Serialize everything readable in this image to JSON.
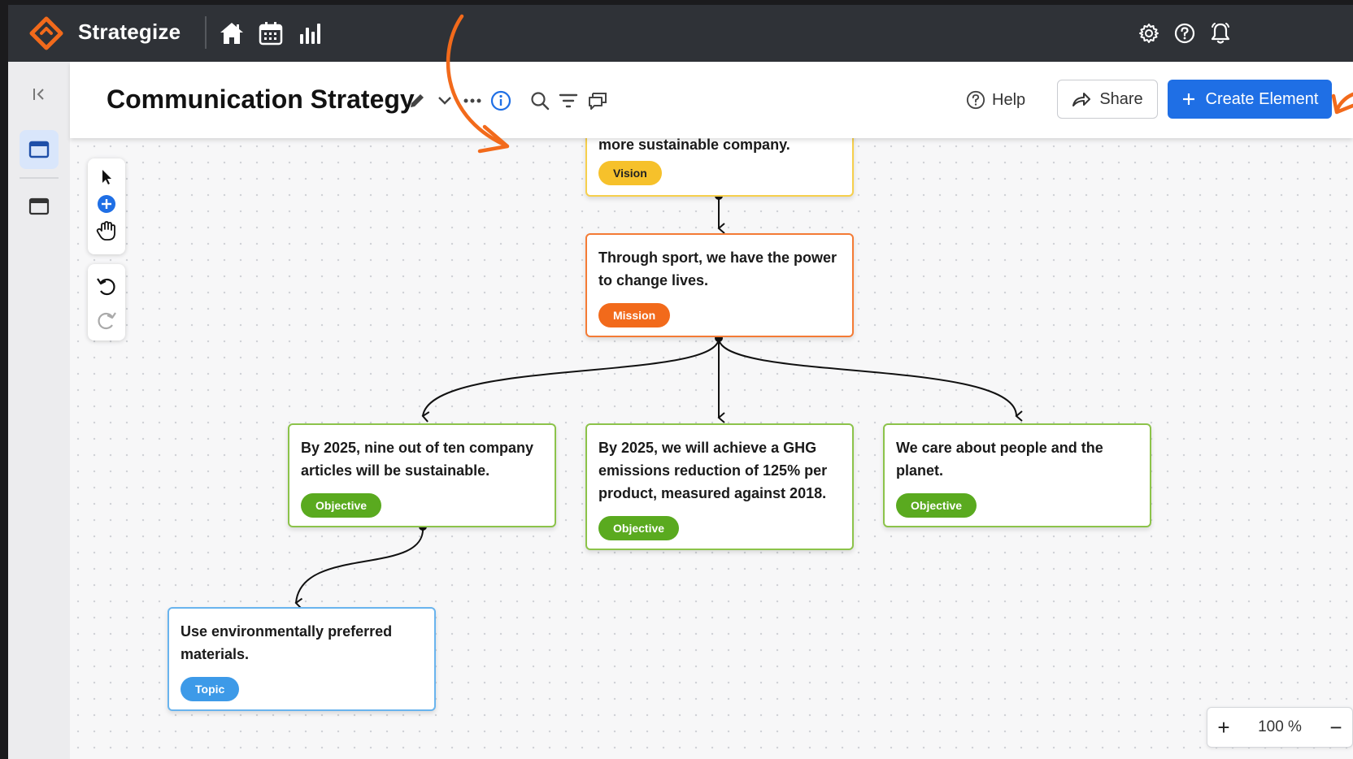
{
  "app": {
    "brand": "Strategize"
  },
  "header": {
    "title": "Communication Strategy",
    "help_label": "Help",
    "share_label": "Share",
    "create_label": "Create Element"
  },
  "cards": {
    "vision": {
      "text": "more sustainable company.",
      "tag": "Vision"
    },
    "mission": {
      "text": "Through sport, we have the power to change lives.",
      "tag": "Mission"
    },
    "objective1": {
      "text": "By 2025, nine out of ten company articles will be sustainable.",
      "tag": "Objective"
    },
    "objective2": {
      "text": "By 2025, we will achieve a GHG emissions reduction of 125% per product, measured against 2018.",
      "tag": "Objective"
    },
    "objective3": {
      "text": "We care about people and the planet.",
      "tag": "Objective"
    },
    "topic1": {
      "text": "Use environmentally preferred materials.",
      "tag": "Topic"
    }
  },
  "zoom": {
    "plus": "+",
    "value": "100 %",
    "minus": "−"
  },
  "colors": {
    "vision": "#f6c12b",
    "mission": "#f26a1b",
    "objective": "#5aaa1f",
    "topic": "#3d9ae8",
    "accent": "#1f6fe5",
    "annotation_arrow": "#f26a1b"
  },
  "icons": {
    "appbar": [
      "strategize-logo-icon",
      "home-icon",
      "calendar-icon",
      "bar-chart-icon",
      "settings-icon",
      "help-icon",
      "bell-icon"
    ],
    "header": [
      "edit-pencil-icon",
      "chevron-down-icon",
      "more-icon",
      "info-icon",
      "search-icon",
      "filter-icon",
      "comments-icon"
    ],
    "tools": [
      "pointer-icon",
      "add-icon",
      "hand-icon",
      "undo-icon",
      "redo-icon"
    ]
  }
}
